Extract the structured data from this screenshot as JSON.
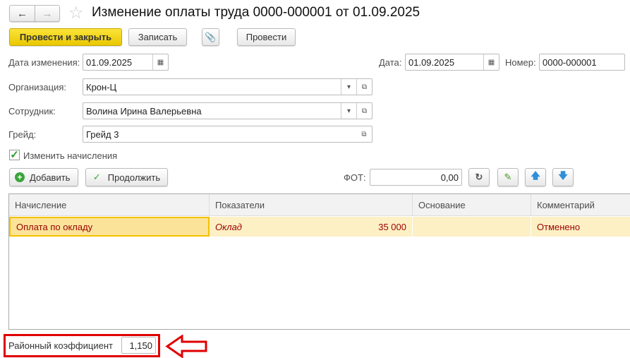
{
  "window": {
    "title": "Изменение оплаты труда 0000-000001 от 01.09.2025"
  },
  "toolbar": {
    "post_close": "Провести и закрыть",
    "save": "Записать",
    "post": "Провести"
  },
  "fields": {
    "change_date_label": "Дата изменения:",
    "change_date": "01.09.2025",
    "date_label": "Дата:",
    "date": "01.09.2025",
    "number_label": "Номер:",
    "number": "0000-000001",
    "org_label": "Организация:",
    "org": "Крон-Ц",
    "employee_label": "Сотрудник:",
    "employee": "Волина Ирина Валерьевна",
    "grade_label": "Грейд:",
    "grade": "Грейд 3",
    "change_accruals_label": "Изменить начисления",
    "change_accruals_checked": true
  },
  "table_toolbar": {
    "add": "Добавить",
    "continue": "Продолжить",
    "fot_label": "ФОТ:",
    "fot": "0,00"
  },
  "table": {
    "columns": [
      "Начисление",
      "Показатели",
      "Основание",
      "Комментарий"
    ],
    "rows": [
      {
        "accrual": "Оплата по окладу",
        "indicator": "Оклад",
        "value": "35 000",
        "basis": "",
        "comment": "Отменено"
      }
    ]
  },
  "footer": {
    "coef_label": "Районный коэффициент",
    "coef": "1,150"
  },
  "colors": {
    "accent": "#f5d000",
    "highlight": "#e00000",
    "row": "#fdf0c4"
  }
}
